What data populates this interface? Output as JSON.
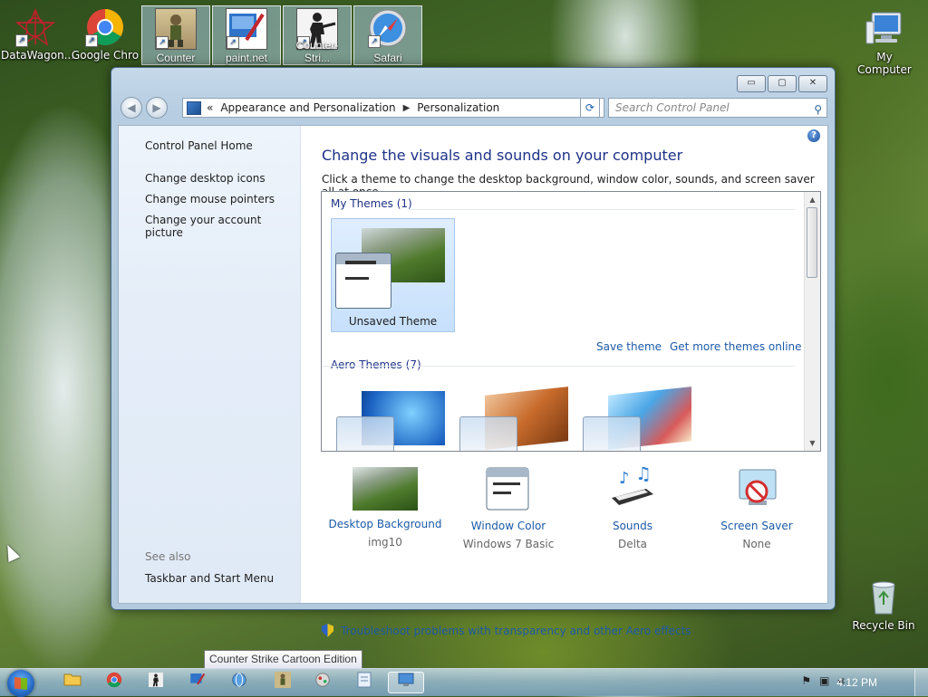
{
  "desktop": {
    "icons": [
      {
        "label": "DataWagon..."
      },
      {
        "label": "Google Chro"
      },
      {
        "label": "My Computer"
      },
      {
        "label": "Recycle Bin"
      }
    ],
    "pinned": [
      {
        "label": "Counter"
      },
      {
        "label": "paint.net"
      },
      {
        "label": "Counter-Stri..."
      },
      {
        "label": "Safari"
      }
    ]
  },
  "window": {
    "controls": {
      "minimize": "▭",
      "maximize": "▢",
      "close": "✕"
    },
    "nav": {
      "back": "◀",
      "forward": "▶"
    },
    "breadcrumb": {
      "prefix": "«",
      "item1": "Appearance and Personalization",
      "separator": "▶",
      "item2": "Personalization"
    },
    "search": {
      "placeholder": "Search Control Panel"
    },
    "sidebar": {
      "home": "Control Panel Home",
      "links": [
        "Change desktop icons",
        "Change mouse pointers",
        "Change your account picture"
      ],
      "see_also_heading": "See also",
      "see_also_links": [
        "Taskbar and Start Menu"
      ]
    },
    "main": {
      "title": "Change the visuals and sounds on your computer",
      "subtitle": "Click a theme to change the desktop background, window color, sounds, and screen saver all at once.",
      "my_themes_heading": "My Themes (1)",
      "unsaved_theme_label": "Unsaved Theme",
      "save_theme": "Save theme",
      "get_more_themes": "Get more themes online",
      "aero_themes_heading": "Aero Themes (7)",
      "options": [
        {
          "label": "Desktop Background",
          "value": "img10"
        },
        {
          "label": "Window Color",
          "value": "Windows 7 Basic"
        },
        {
          "label": "Sounds",
          "value": "Delta"
        },
        {
          "label": "Screen Saver",
          "value": "None"
        }
      ],
      "troubleshoot": "Troubleshoot problems with transparency and other Aero effects"
    }
  },
  "tooltip": {
    "text": "Counter Strike Cartoon Edition"
  },
  "taskbar": {
    "clock": "4:12 PM"
  },
  "colors": {
    "link": "#1c5aa8",
    "heading": "#1e3287"
  }
}
